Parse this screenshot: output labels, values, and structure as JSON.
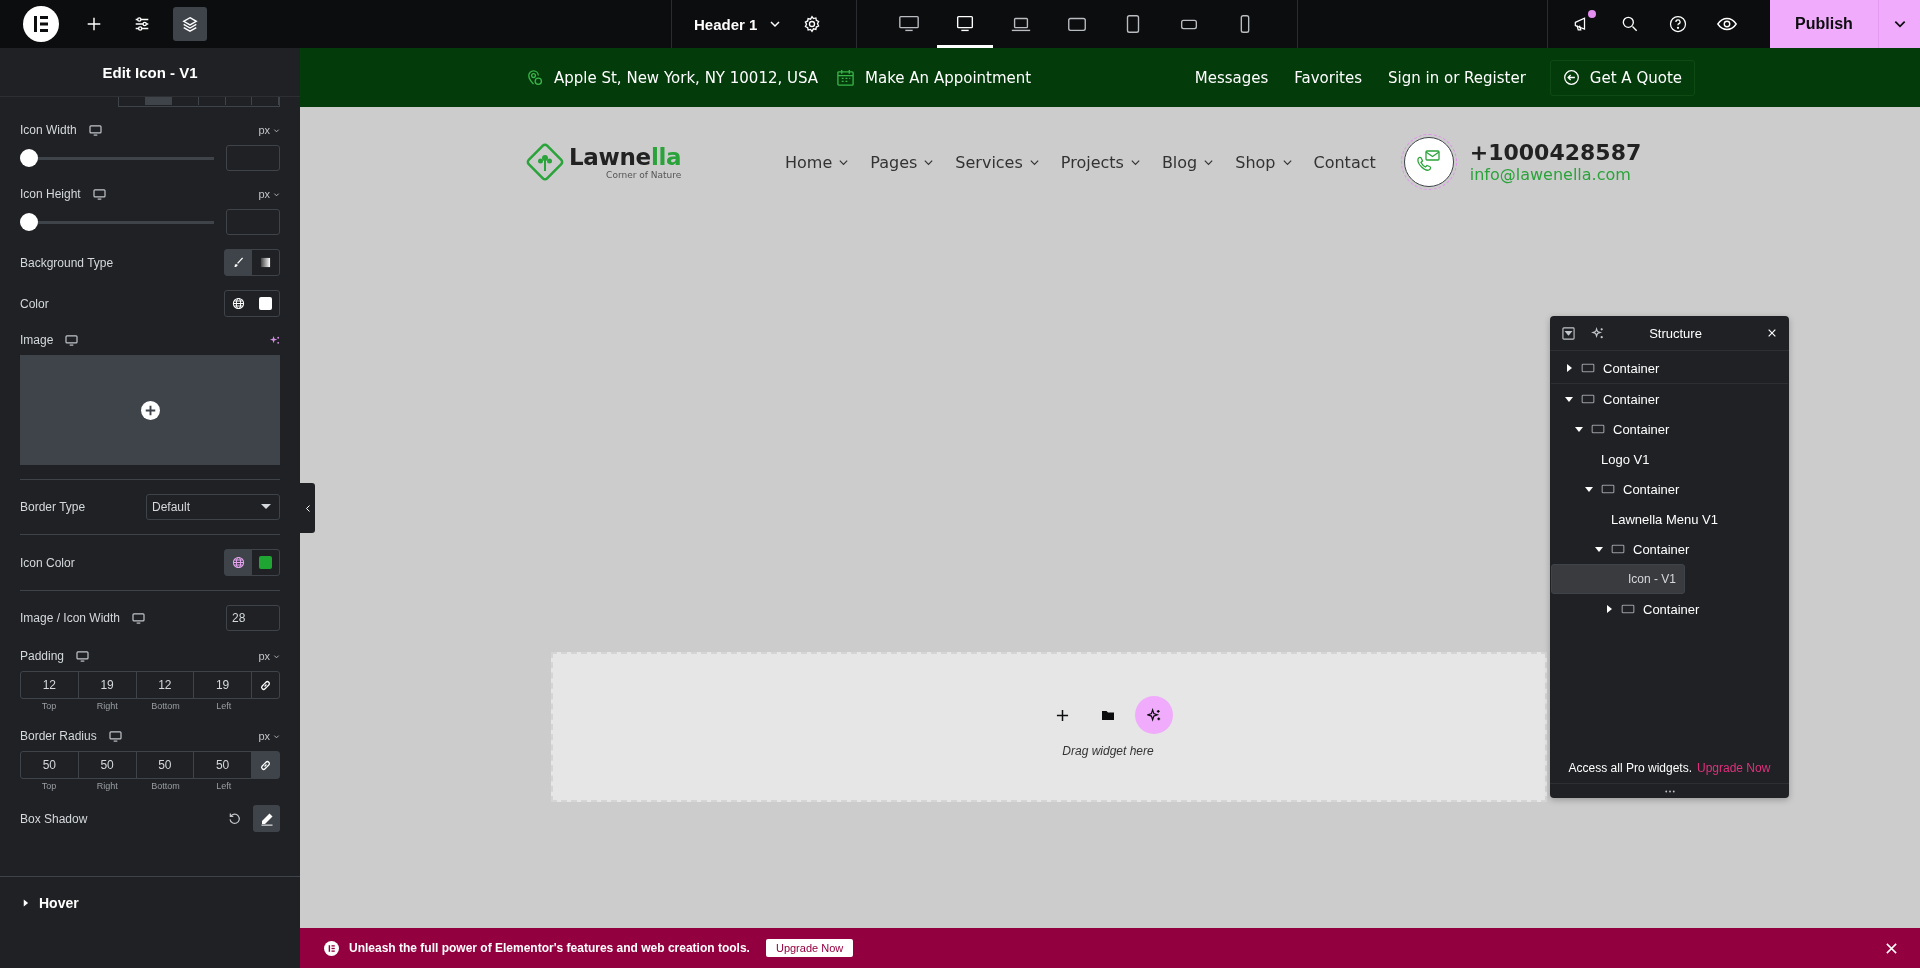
{
  "topbar": {
    "tools": [
      {
        "kind": "add",
        "selected": false
      },
      {
        "kind": "settings",
        "selected": false
      },
      {
        "kind": "layers",
        "selected": true
      }
    ],
    "document": {
      "title": "Header 1"
    },
    "devices": [
      {
        "kind": "desktop",
        "selected": false
      },
      {
        "kind": "monitor",
        "selected": true
      },
      {
        "kind": "laptop",
        "selected": false
      },
      {
        "kind": "tablet-landscape",
        "selected": false
      },
      {
        "kind": "tablet",
        "selected": false
      },
      {
        "kind": "phone-landscape",
        "selected": false
      },
      {
        "kind": "phone",
        "selected": false
      }
    ],
    "notifications": true,
    "publish": {
      "label": "Publish"
    }
  },
  "panel": {
    "title": "Edit Icon - V1",
    "segments": [
      {
        "selected": false
      },
      {
        "selected": true
      },
      {
        "selected": false
      },
      {
        "selected": false
      },
      {
        "selected": false
      },
      {
        "selected": false
      }
    ],
    "controls": [
      {
        "kind": "slider",
        "label": "Icon Width",
        "responsive": true,
        "unit": "px",
        "level": 0,
        "divider_before": false
      },
      {
        "kind": "slider",
        "label": "Icon Height",
        "responsive": true,
        "unit": "px",
        "level": 0,
        "divider_before": false
      },
      {
        "kind": "choices",
        "label": "Background Type",
        "responsive": false,
        "divider_before": false,
        "options": [
          {
            "kind": "brush",
            "selected": true
          },
          {
            "kind": "gradient",
            "selected": false
          }
        ]
      },
      {
        "kind": "color",
        "label": "Color",
        "responsive": false,
        "divider_before": false,
        "global_active": false,
        "color": "#ffffff"
      },
      {
        "kind": "media",
        "label": "Image",
        "responsive": true,
        "divider_before": false
      },
      {
        "kind": "select",
        "label": "Border Type",
        "responsive": false,
        "divider_before": true,
        "value": "Default"
      },
      {
        "kind": "color",
        "label": "Icon Color",
        "responsive": false,
        "divider_before": true,
        "global_active": true,
        "color": "#1fa532"
      },
      {
        "kind": "number",
        "label": "Image / Icon Width",
        "responsive": true,
        "divider_before": true,
        "value": "28"
      },
      {
        "kind": "dimensions",
        "label": "Padding",
        "responsive": true,
        "divider_before": false,
        "unit": "px",
        "linked": false,
        "fields": [
          {
            "value": "12",
            "label": "Top"
          },
          {
            "value": "19",
            "label": "Right"
          },
          {
            "value": "12",
            "label": "Bottom"
          },
          {
            "value": "19",
            "label": "Left"
          }
        ]
      },
      {
        "kind": "dimensions",
        "label": "Border Radius",
        "responsive": true,
        "divider_before": false,
        "unit": "px",
        "linked": true,
        "fields": [
          {
            "value": "50",
            "label": "Top"
          },
          {
            "value": "50",
            "label": "Right"
          },
          {
            "value": "50",
            "label": "Bottom"
          },
          {
            "value": "50",
            "label": "Left"
          }
        ]
      },
      {
        "kind": "popover",
        "label": "Box Shadow",
        "responsive": false,
        "divider_before": false,
        "active": true
      }
    ],
    "sections": [
      {
        "title": "Hover",
        "expanded": false
      }
    ]
  },
  "site": {
    "topbar": {
      "info": [
        {
          "kind": "location",
          "text": "Apple St, New York, NY 10012, USA"
        },
        {
          "kind": "calendar",
          "text": "Make An Appointment"
        }
      ],
      "links": [
        "Messages",
        "Favorites",
        "Sign in or Register"
      ],
      "button": "Get A Quote"
    },
    "logo": {
      "name_start": "Lawne",
      "name_accent": "lla",
      "tagline": "Corner of Nature"
    },
    "nav": [
      {
        "label": "Home",
        "dropdown": true
      },
      {
        "label": "Pages",
        "dropdown": true
      },
      {
        "label": "Services",
        "dropdown": true
      },
      {
        "label": "Projects",
        "dropdown": true
      },
      {
        "label": "Blog",
        "dropdown": true
      },
      {
        "label": "Shop",
        "dropdown": true
      },
      {
        "label": "Contact",
        "dropdown": false
      }
    ],
    "contact": {
      "selected": true,
      "phone": "+1000428587",
      "email": "info@lawenella.com"
    },
    "dropzone": {
      "hint": "Drag widget here"
    }
  },
  "structure": {
    "title": "Structure",
    "tree": [
      {
        "kind": "container",
        "label": "Container",
        "expanded": false,
        "selected": false
      },
      {
        "kind": "container",
        "label": "Container",
        "expanded": true,
        "selected": false,
        "children": [
          {
            "kind": "container",
            "label": "Container",
            "expanded": true,
            "selected": false,
            "children": [
              {
                "kind": "widget",
                "label": "Logo V1",
                "selected": false
              },
              {
                "kind": "container",
                "label": "Container",
                "expanded": true,
                "selected": false,
                "children": [
                  {
                    "kind": "widget",
                    "label": "Lawnella Menu V1",
                    "selected": false
                  },
                  {
                    "kind": "container",
                    "label": "Container",
                    "expanded": true,
                    "selected": false,
                    "children": [
                      {
                        "kind": "widget",
                        "label": "Icon - V1",
                        "selected": true
                      },
                      {
                        "kind": "container",
                        "label": "Container",
                        "expanded": false,
                        "selected": false
                      }
                    ]
                  }
                ]
              }
            ]
          }
        ]
      }
    ],
    "promo": "Access all Pro widgets.",
    "promo_link": "Upgrade Now"
  },
  "banner": {
    "text": "Unleash the full power of Elementor's features and web creation tools.",
    "button": "Upgrade Now"
  }
}
